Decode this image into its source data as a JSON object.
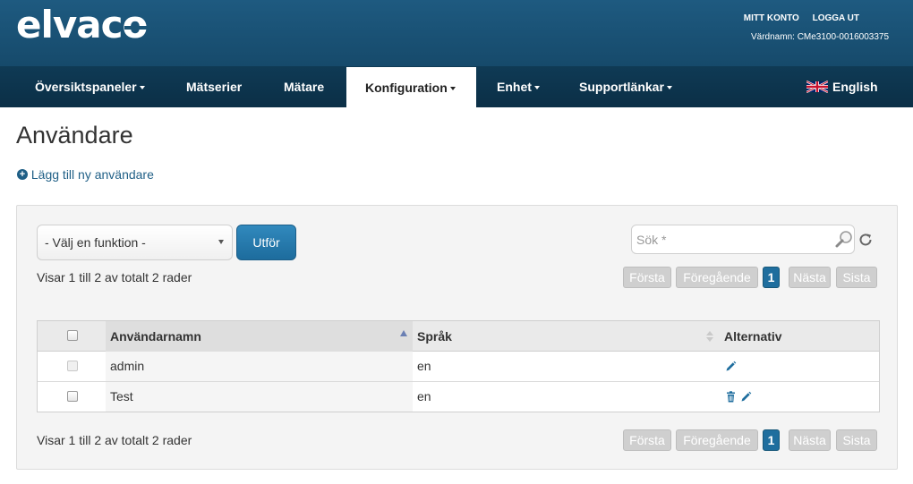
{
  "header": {
    "logo": "elvaco",
    "my_account": "MITT KONTO",
    "logout": "LOGGA UT",
    "hostname": "Värdnamn: CMe3100-0016003375"
  },
  "nav": {
    "items": [
      {
        "label": "Översiktspaneler",
        "dropdown": true
      },
      {
        "label": "Mätserier",
        "dropdown": false
      },
      {
        "label": "Mätare",
        "dropdown": false
      },
      {
        "label": "Konfiguration",
        "dropdown": true,
        "active": true
      },
      {
        "label": "Enhet",
        "dropdown": true
      },
      {
        "label": "Supportlänkar",
        "dropdown": true
      }
    ],
    "language": "English",
    "language_icon": "uk-flag-icon"
  },
  "page": {
    "title": "Användare",
    "add_user": "Lägg till ny användare"
  },
  "toolbar": {
    "function_select": "- Välj en funktion -",
    "run_button": "Utför",
    "search_placeholder": "Sök *"
  },
  "info_text": "Visar 1 till 2 av totalt 2 rader",
  "pagination": {
    "first": "Första",
    "previous": "Föregående",
    "current": "1",
    "next": "Nästa",
    "last": "Sista"
  },
  "table": {
    "columns": [
      "Användarnamn",
      "Språk",
      "Alternativ"
    ],
    "rows": [
      {
        "username": "admin",
        "language": "en",
        "actions": [
          "edit"
        ]
      },
      {
        "username": "Test",
        "language": "en",
        "actions": [
          "delete",
          "edit"
        ]
      }
    ]
  },
  "colors": {
    "header": "#1e5a80",
    "nav": "#0f3a55",
    "accent": "#1f6e9e",
    "link": "#1f5f86"
  }
}
